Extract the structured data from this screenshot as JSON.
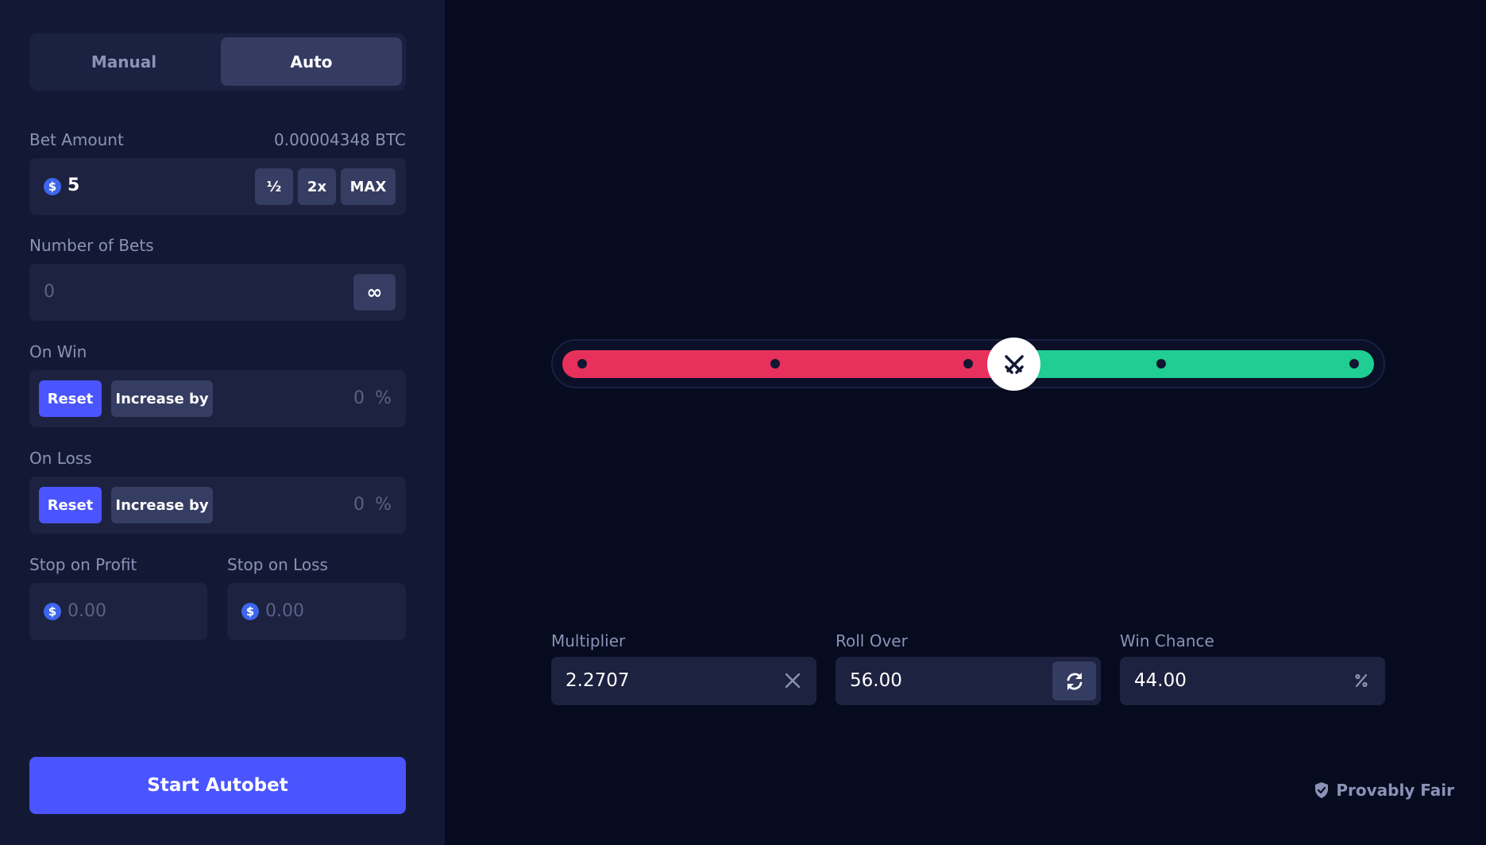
{
  "mode_tabs": {
    "manual": "Manual",
    "auto": "Auto"
  },
  "bet_amount": {
    "label": "Bet Amount",
    "btc_value": "0.00004348 BTC",
    "currency_symbol": "$",
    "value": "5",
    "half_label": "½",
    "double_label": "2x",
    "max_label": "MAX"
  },
  "number_of_bets": {
    "label": "Number of Bets",
    "placeholder": "0",
    "infinity_label": "∞"
  },
  "on_win": {
    "label": "On Win",
    "reset_label": "Reset",
    "increase_label": "Increase by",
    "value": "0",
    "unit": "%"
  },
  "on_loss": {
    "label": "On Loss",
    "reset_label": "Reset",
    "increase_label": "Increase by",
    "value": "0",
    "unit": "%"
  },
  "stop_on_profit": {
    "label": "Stop on Profit",
    "currency_symbol": "$",
    "placeholder": "0.00"
  },
  "stop_on_loss": {
    "label": "Stop on Loss",
    "currency_symbol": "$",
    "placeholder": "0.00"
  },
  "start_button": "Start Autobet",
  "slider": {
    "roll_over_value": 56,
    "colors": {
      "lose": "#e8305c",
      "win": "#20cd92"
    }
  },
  "multiplier": {
    "label": "Multiplier",
    "value": "2.2707"
  },
  "roll_over": {
    "label": "Roll Over",
    "value": "56.00"
  },
  "win_chance": {
    "label": "Win Chance",
    "value": "44.00"
  },
  "provably_fair": "Provably Fair",
  "colors": {
    "accent": "#4a55ff",
    "sidebar": "#131934",
    "background": "#070b1f"
  }
}
